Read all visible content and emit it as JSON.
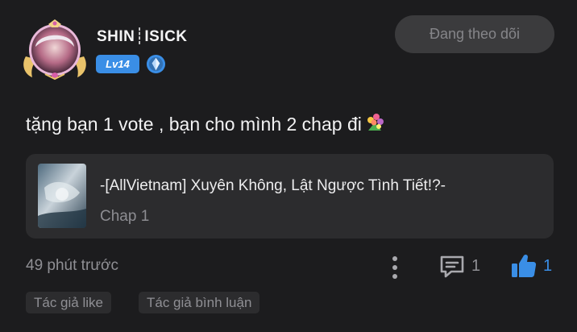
{
  "user": {
    "name": "SHIN┊ISICK",
    "level": "Lv14",
    "level_color": "#3a8ee6",
    "avatar_icon": "user-avatar-with-angel-frame",
    "rank_icon": "diamond-rank-icon"
  },
  "follow_button": {
    "label": "Đang theo dõi"
  },
  "comment": {
    "text": "tặng bạn 1 vote , bạn cho mình 2 chap đi",
    "emoji": "bouquet"
  },
  "story": {
    "title": "-[AllVietnam] Xuyên Không, Lật Ngược Tình Tiết!?-",
    "chapter": "Chap 1",
    "thumbnail_icon": "story-cover-image"
  },
  "footer": {
    "time": "49 phút trước",
    "comment_count": "1",
    "like_count": "1",
    "like_color": "#3a8ee6"
  },
  "tags": [
    {
      "label": "Tác giả like"
    },
    {
      "label": "Tác giả bình luận"
    }
  ]
}
